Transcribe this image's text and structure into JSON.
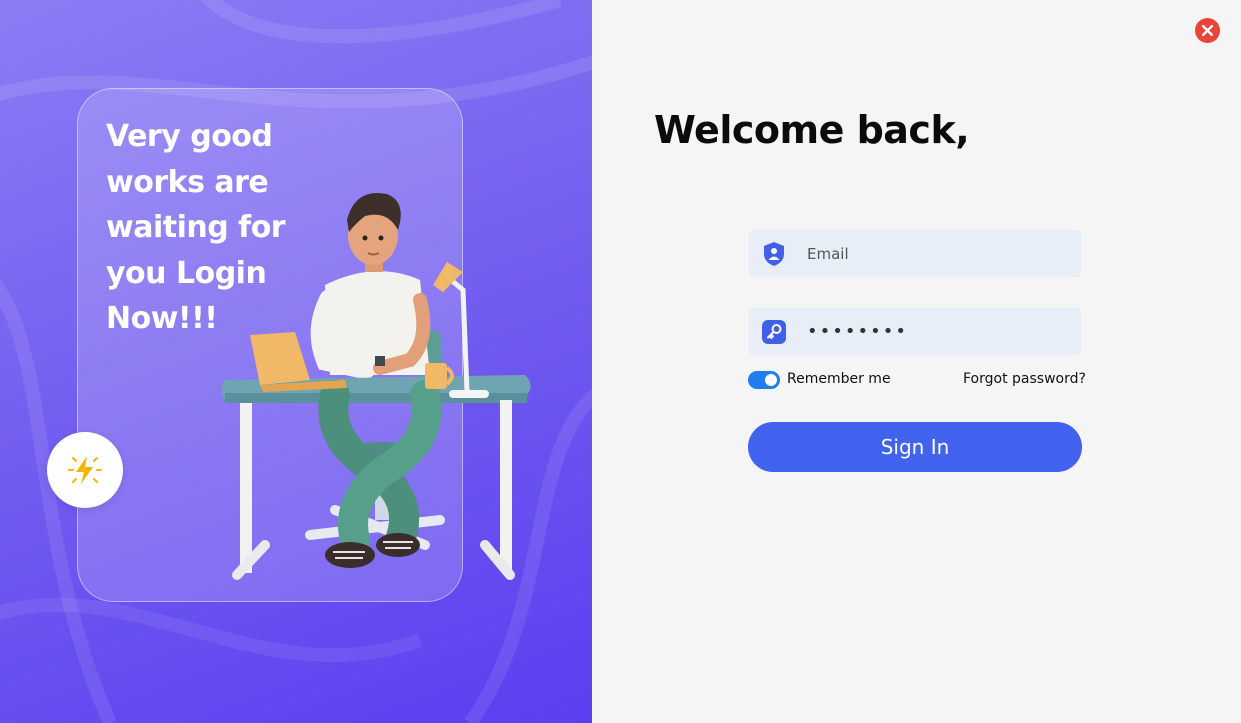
{
  "promo": {
    "tagline": "Very good works are waiting for you Login Now!!!"
  },
  "form": {
    "title": "Welcome back,",
    "email_placeholder": "Email",
    "email_value": "",
    "password_value": "••••••••",
    "remember_label": "Remember me",
    "remember_checked": true,
    "forgot_label": "Forgot password?",
    "signin_label": "Sign In"
  },
  "icons": {
    "close": "close-icon",
    "bolt": "lightning-bolt-icon",
    "email": "user-shield-icon",
    "password": "key-icon"
  },
  "colors": {
    "left_gradient_top": "#8b7cf4",
    "left_gradient_bottom": "#5a3ff0",
    "right_background": "#f5f5f5",
    "primary_button": "#4263f0",
    "toggle_on": "#1e80f0",
    "close_red": "#e8453a",
    "field_background": "#e8eef7",
    "icon_blue": "#4160e8"
  }
}
